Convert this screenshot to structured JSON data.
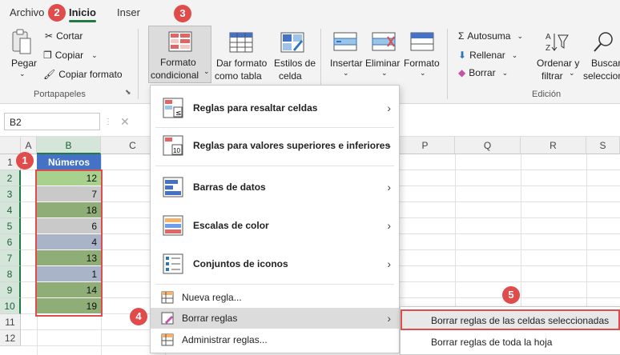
{
  "tabs": {
    "archivo": "Archivo",
    "inicio": "Inicio",
    "insertar": "Inser"
  },
  "ribbon": {
    "pegar": "Pegar",
    "cortar": "Cortar",
    "copiar": "Copiar",
    "copiar_formato": "Copiar formato",
    "portapapeles": "Portapapeles",
    "formato_condicional_1": "Formato",
    "formato_condicional_2": "condicional",
    "dar_formato_1": "Dar formato",
    "dar_formato_2": "como tabla",
    "estilos_1": "Estilos de",
    "estilos_2": "celda",
    "insertar": "Insertar",
    "eliminar": "Eliminar",
    "formato": "Formato",
    "autosuma": "Autosuma",
    "rellenar": "Rellenar",
    "borrar": "Borrar",
    "ordenar_1": "Ordenar y",
    "ordenar_2": "filtrar",
    "buscar_1": "Buscar",
    "buscar_2": "seleccionar",
    "edicion": "Edición"
  },
  "formula_bar": {
    "name_box": "B2",
    "cancel": "✕"
  },
  "grid": {
    "columns": [
      "A",
      "B",
      "C",
      "P",
      "Q",
      "R",
      "S"
    ],
    "rows": [
      "1",
      "2",
      "3",
      "4",
      "5",
      "6",
      "7",
      "8",
      "9",
      "10",
      "11",
      "12"
    ],
    "header_cell": "Números",
    "values": [
      "12",
      "7",
      "18",
      "6",
      "4",
      "13",
      "1",
      "14",
      "19"
    ],
    "fills": [
      "#a9d18e",
      "#c9c9c9",
      "#8fad76",
      "#c9c9c9",
      "#aab4c8",
      "#8fad76",
      "#aab4c8",
      "#8fad76",
      "#8fad76"
    ]
  },
  "menu": {
    "items": [
      {
        "label": "Reglas para resaltar celdas"
      },
      {
        "label": "Reglas para valores superiores e inferiores"
      },
      {
        "label": "Barras de datos"
      },
      {
        "label": "Escalas de color"
      },
      {
        "label": "Conjuntos de iconos"
      },
      {
        "label": "Nueva regla..."
      },
      {
        "label": "Borrar reglas"
      },
      {
        "label": "Administrar reglas..."
      }
    ],
    "arrow": "›"
  },
  "submenu": {
    "items": [
      {
        "label": "Borrar reglas de las celdas seleccionadas"
      },
      {
        "label": "Borrar reglas de toda la hoja"
      }
    ]
  },
  "badges": [
    "1",
    "2",
    "3",
    "4",
    "5"
  ],
  "colors": {
    "accent": "#1f7a44",
    "badge": "#e04b4b",
    "table_header": "#4472c4"
  }
}
